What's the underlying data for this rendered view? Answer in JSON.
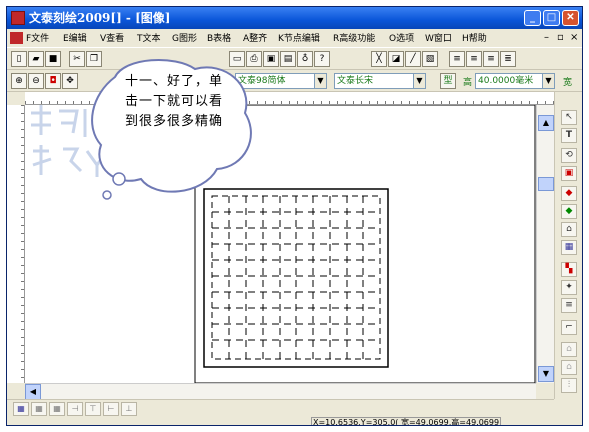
{
  "window": {
    "title": "文泰刻绘2009[] - [图像]"
  },
  "menu": {
    "items": [
      {
        "label": "F文件"
      },
      {
        "label": "E编辑"
      },
      {
        "label": "V查看"
      },
      {
        "label": "T文本"
      },
      {
        "label": "G图形"
      },
      {
        "label": "B表格"
      },
      {
        "label": "A整齐"
      },
      {
        "label": "K节点编辑"
      },
      {
        "label": "R高级功能"
      },
      {
        "label": "O选项"
      },
      {
        "label": "W窗口"
      },
      {
        "label": "H帮助"
      }
    ]
  },
  "toolbar2": {
    "font_combo": "文泰98简体",
    "font2_combo": "文泰长宋",
    "height_label": "高",
    "height_value": "40.0000毫米",
    "width_label": "宽"
  },
  "bubble": {
    "line1": "十一、好了，单",
    "line2": "击一下就可以看",
    "line3": "到很多很多精确"
  },
  "status": {
    "coords": "X=10.6536,Y=305.0( 宽=49.0699,高=49.0699"
  },
  "colors": {
    "titlebar": "#0a55d8",
    "accent_green": "#1a7a1a",
    "brand_red": "#c0282a"
  }
}
